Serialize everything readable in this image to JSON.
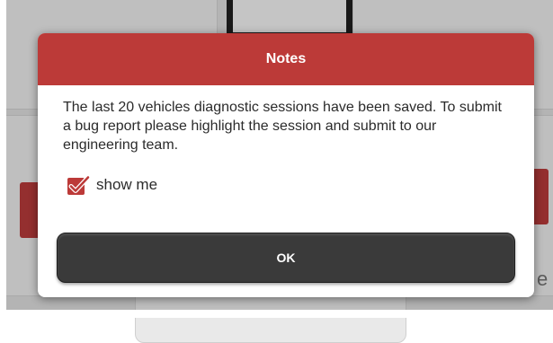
{
  "dialog": {
    "title": "Notes",
    "message": "The last 20 vehicles diagnostic sessions have been saved. To submit a bug report please highlight the session and submit to our engineering team.",
    "checkbox": {
      "label": "show me",
      "checked": true,
      "icon": "checkmark-icon"
    },
    "ok_label": "OK"
  },
  "background": {
    "partial_text": "e"
  },
  "colors": {
    "header": "#bc3a38",
    "button": "#3a3a3a",
    "checkbox": "#bc3a38"
  }
}
